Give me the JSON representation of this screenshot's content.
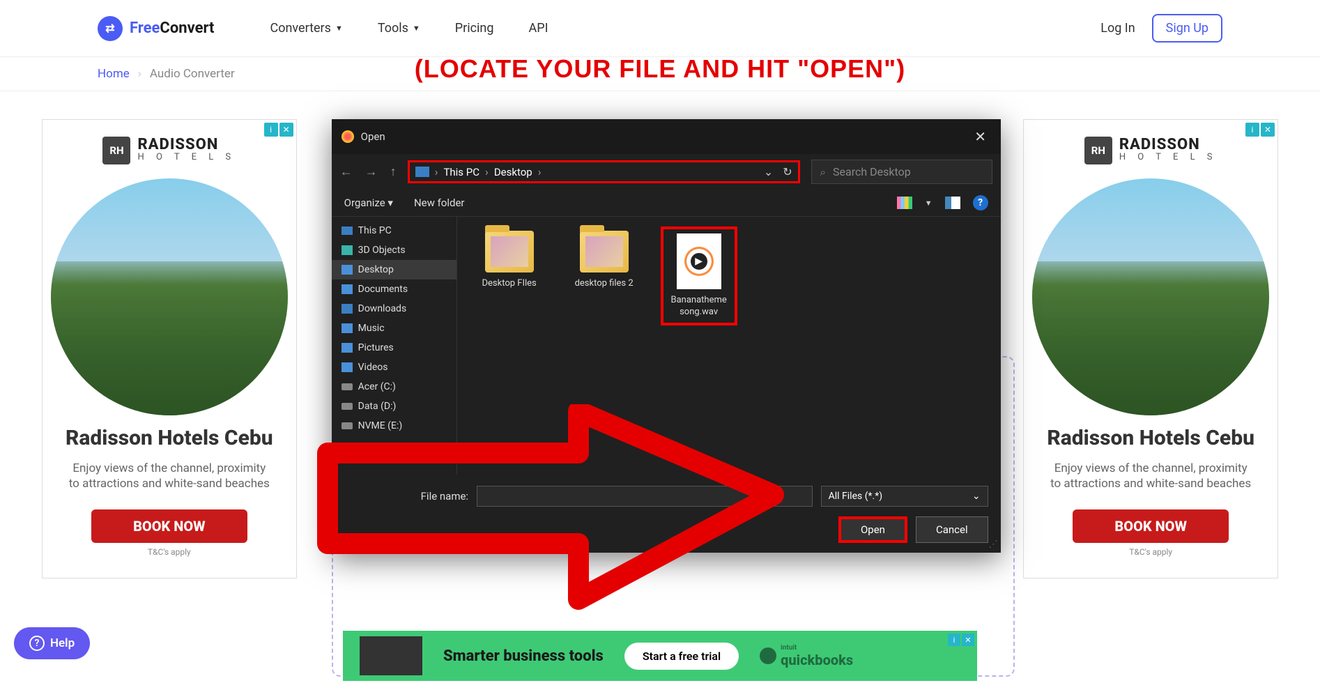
{
  "header": {
    "logo_free": "Free",
    "logo_convert": "Convert",
    "nav": {
      "converters": "Converters",
      "tools": "Tools",
      "pricing": "Pricing",
      "api": "API"
    },
    "login": "Log In",
    "signup": "Sign Up"
  },
  "breadcrumb": {
    "home": "Home",
    "current": "Audio Converter"
  },
  "banner": "(LOCATE YOUR FILE AND HIT \"OPEN\")",
  "ad": {
    "brand": "RADISSON",
    "brand_sub": "H O T E L S",
    "title": "Radisson Hotels Cebu",
    "subtitle": "Enjoy views of the channel, proximity to attractions and white-sand beaches",
    "btn": "BOOK NOW",
    "tc": "T&C's apply"
  },
  "dialog": {
    "title": "Open",
    "path": {
      "root": "This PC",
      "folder": "Desktop"
    },
    "search_placeholder": "Search Desktop",
    "organize": "Organize",
    "new_folder": "New folder",
    "tree": {
      "this_pc": "This PC",
      "objects3d": "3D Objects",
      "desktop": "Desktop",
      "documents": "Documents",
      "downloads": "Downloads",
      "music": "Music",
      "pictures": "Pictures",
      "videos": "Videos",
      "drive_c": "Acer (C:)",
      "drive_d": "Data (D:)",
      "drive_e": "NVME (E:)"
    },
    "files": {
      "f1": "Desktop FIles",
      "f2": "desktop files 2",
      "f3": "Bananatheme song.wav"
    },
    "file_name_label": "File name:",
    "filter": "All Files (*.*)",
    "open_btn": "Open",
    "cancel_btn": "Cancel"
  },
  "bottom_ad": {
    "text": "Smarter business tools",
    "trial": "Start a free trial",
    "brand_pre": "intuit",
    "brand": "quickbooks"
  },
  "help": "Help"
}
